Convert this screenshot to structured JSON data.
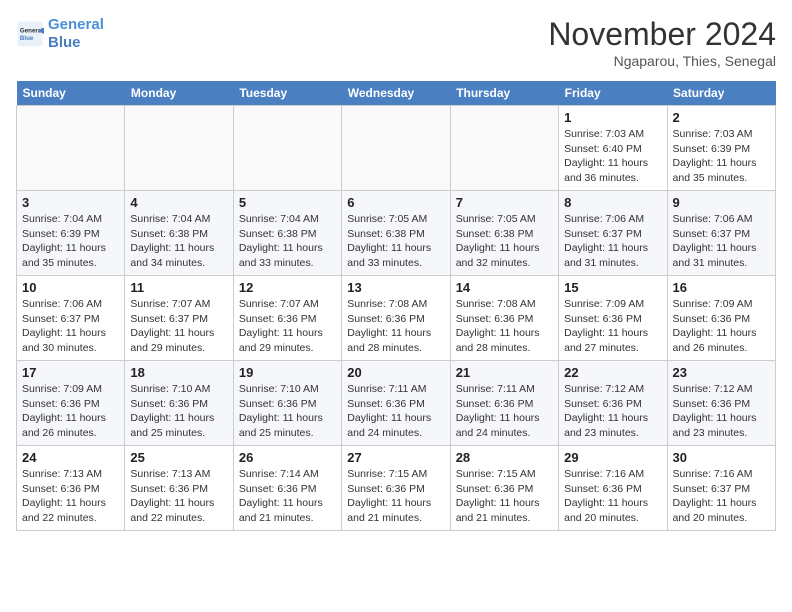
{
  "header": {
    "logo_line1": "General",
    "logo_line2": "Blue",
    "month": "November 2024",
    "location": "Ngaparou, Thies, Senegal"
  },
  "days_of_week": [
    "Sunday",
    "Monday",
    "Tuesday",
    "Wednesday",
    "Thursday",
    "Friday",
    "Saturday"
  ],
  "weeks": [
    [
      {
        "day": "",
        "info": ""
      },
      {
        "day": "",
        "info": ""
      },
      {
        "day": "",
        "info": ""
      },
      {
        "day": "",
        "info": ""
      },
      {
        "day": "",
        "info": ""
      },
      {
        "day": "1",
        "info": "Sunrise: 7:03 AM\nSunset: 6:40 PM\nDaylight: 11 hours\nand 36 minutes."
      },
      {
        "day": "2",
        "info": "Sunrise: 7:03 AM\nSunset: 6:39 PM\nDaylight: 11 hours\nand 35 minutes."
      }
    ],
    [
      {
        "day": "3",
        "info": "Sunrise: 7:04 AM\nSunset: 6:39 PM\nDaylight: 11 hours\nand 35 minutes."
      },
      {
        "day": "4",
        "info": "Sunrise: 7:04 AM\nSunset: 6:38 PM\nDaylight: 11 hours\nand 34 minutes."
      },
      {
        "day": "5",
        "info": "Sunrise: 7:04 AM\nSunset: 6:38 PM\nDaylight: 11 hours\nand 33 minutes."
      },
      {
        "day": "6",
        "info": "Sunrise: 7:05 AM\nSunset: 6:38 PM\nDaylight: 11 hours\nand 33 minutes."
      },
      {
        "day": "7",
        "info": "Sunrise: 7:05 AM\nSunset: 6:38 PM\nDaylight: 11 hours\nand 32 minutes."
      },
      {
        "day": "8",
        "info": "Sunrise: 7:06 AM\nSunset: 6:37 PM\nDaylight: 11 hours\nand 31 minutes."
      },
      {
        "day": "9",
        "info": "Sunrise: 7:06 AM\nSunset: 6:37 PM\nDaylight: 11 hours\nand 31 minutes."
      }
    ],
    [
      {
        "day": "10",
        "info": "Sunrise: 7:06 AM\nSunset: 6:37 PM\nDaylight: 11 hours\nand 30 minutes."
      },
      {
        "day": "11",
        "info": "Sunrise: 7:07 AM\nSunset: 6:37 PM\nDaylight: 11 hours\nand 29 minutes."
      },
      {
        "day": "12",
        "info": "Sunrise: 7:07 AM\nSunset: 6:36 PM\nDaylight: 11 hours\nand 29 minutes."
      },
      {
        "day": "13",
        "info": "Sunrise: 7:08 AM\nSunset: 6:36 PM\nDaylight: 11 hours\nand 28 minutes."
      },
      {
        "day": "14",
        "info": "Sunrise: 7:08 AM\nSunset: 6:36 PM\nDaylight: 11 hours\nand 28 minutes."
      },
      {
        "day": "15",
        "info": "Sunrise: 7:09 AM\nSunset: 6:36 PM\nDaylight: 11 hours\nand 27 minutes."
      },
      {
        "day": "16",
        "info": "Sunrise: 7:09 AM\nSunset: 6:36 PM\nDaylight: 11 hours\nand 26 minutes."
      }
    ],
    [
      {
        "day": "17",
        "info": "Sunrise: 7:09 AM\nSunset: 6:36 PM\nDaylight: 11 hours\nand 26 minutes."
      },
      {
        "day": "18",
        "info": "Sunrise: 7:10 AM\nSunset: 6:36 PM\nDaylight: 11 hours\nand 25 minutes."
      },
      {
        "day": "19",
        "info": "Sunrise: 7:10 AM\nSunset: 6:36 PM\nDaylight: 11 hours\nand 25 minutes."
      },
      {
        "day": "20",
        "info": "Sunrise: 7:11 AM\nSunset: 6:36 PM\nDaylight: 11 hours\nand 24 minutes."
      },
      {
        "day": "21",
        "info": "Sunrise: 7:11 AM\nSunset: 6:36 PM\nDaylight: 11 hours\nand 24 minutes."
      },
      {
        "day": "22",
        "info": "Sunrise: 7:12 AM\nSunset: 6:36 PM\nDaylight: 11 hours\nand 23 minutes."
      },
      {
        "day": "23",
        "info": "Sunrise: 7:12 AM\nSunset: 6:36 PM\nDaylight: 11 hours\nand 23 minutes."
      }
    ],
    [
      {
        "day": "24",
        "info": "Sunrise: 7:13 AM\nSunset: 6:36 PM\nDaylight: 11 hours\nand 22 minutes."
      },
      {
        "day": "25",
        "info": "Sunrise: 7:13 AM\nSunset: 6:36 PM\nDaylight: 11 hours\nand 22 minutes."
      },
      {
        "day": "26",
        "info": "Sunrise: 7:14 AM\nSunset: 6:36 PM\nDaylight: 11 hours\nand 21 minutes."
      },
      {
        "day": "27",
        "info": "Sunrise: 7:15 AM\nSunset: 6:36 PM\nDaylight: 11 hours\nand 21 minutes."
      },
      {
        "day": "28",
        "info": "Sunrise: 7:15 AM\nSunset: 6:36 PM\nDaylight: 11 hours\nand 21 minutes."
      },
      {
        "day": "29",
        "info": "Sunrise: 7:16 AM\nSunset: 6:36 PM\nDaylight: 11 hours\nand 20 minutes."
      },
      {
        "day": "30",
        "info": "Sunrise: 7:16 AM\nSunset: 6:37 PM\nDaylight: 11 hours\nand 20 minutes."
      }
    ]
  ]
}
